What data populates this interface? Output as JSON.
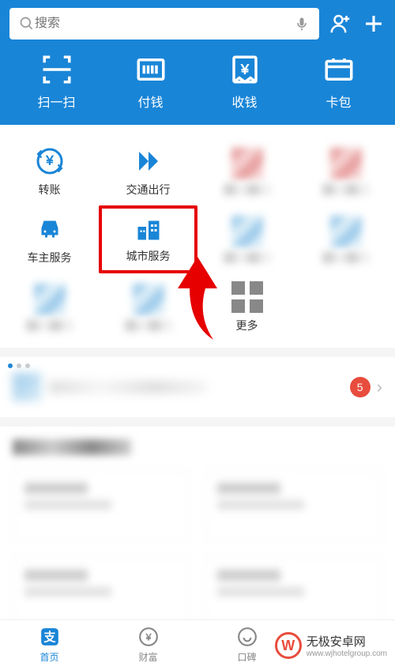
{
  "search": {
    "placeholder": "搜索"
  },
  "actions": {
    "scan": "扫一扫",
    "pay": "付钱",
    "collect": "收钱",
    "card": "卡包"
  },
  "grid": {
    "transfer": "转账",
    "transport": "交通出行",
    "car": "车主服务",
    "city": "城市服务",
    "more": "更多"
  },
  "banner": {
    "badge": "5"
  },
  "tabs": {
    "home": "首页",
    "wealth": "财富",
    "koubei": "口碑"
  },
  "watermark": {
    "name": "无极安卓网",
    "url": "www.wjhotelgroup.com"
  }
}
